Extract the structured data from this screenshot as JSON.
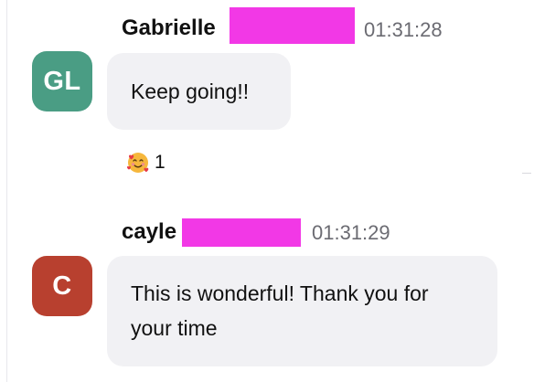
{
  "colors": {
    "avatar_gl": "#4a9d84",
    "avatar_c": "#b8402f",
    "redaction": "#f238e6",
    "bubble_bg": "#f1f1f4",
    "timestamp": "#6b6b72"
  },
  "messages": [
    {
      "avatar_initials": "GL",
      "sender": "Gabrielle",
      "time": "01:31:28",
      "text": "Keep going!!",
      "reaction": {
        "icon": "smiling-face-with-hearts-icon",
        "count": "1"
      }
    },
    {
      "avatar_initials": "C",
      "sender": "cayle",
      "time": "01:31:29",
      "text": "This is wonderful! Thank you for your time"
    }
  ]
}
